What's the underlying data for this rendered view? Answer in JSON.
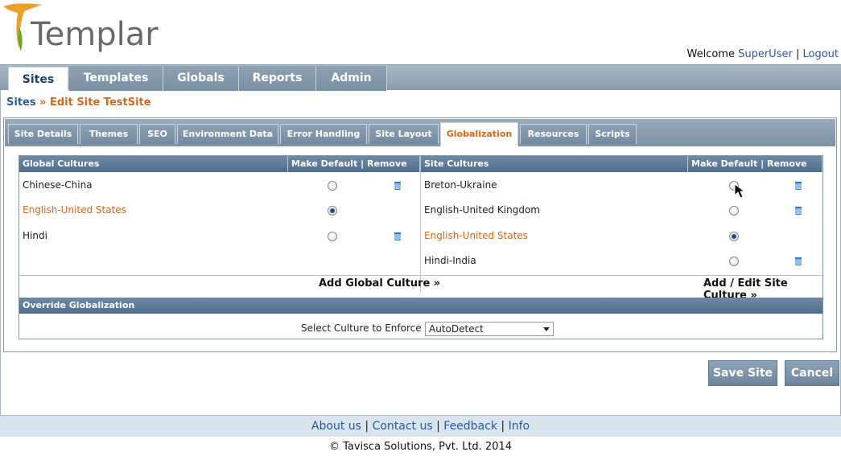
{
  "header": {
    "logo_text": "Templar",
    "welcome": "Welcome",
    "username": "SuperUser",
    "separator": "|",
    "logout": "Logout"
  },
  "mainnav": {
    "tabs": [
      {
        "label": "Sites",
        "active": true
      },
      {
        "label": "Templates",
        "active": false
      },
      {
        "label": "Globals",
        "active": false
      },
      {
        "label": "Reports",
        "active": false
      },
      {
        "label": "Admin",
        "active": false
      }
    ]
  },
  "breadcrumb": {
    "root": "Sites",
    "rest": " » Edit Site TestSite"
  },
  "subtabs": [
    {
      "label": "Site Details"
    },
    {
      "label": "Themes"
    },
    {
      "label": "SEO"
    },
    {
      "label": "Environment Data"
    },
    {
      "label": "Error Handling"
    },
    {
      "label": "Site Layout"
    },
    {
      "label": "Globalization",
      "active": true
    },
    {
      "label": "Resources"
    },
    {
      "label": "Scripts"
    }
  ],
  "global_cultures": {
    "header": "Global Cultures",
    "actions_header": "Make Default | Remove",
    "rows": [
      {
        "name": "Chinese-China",
        "default": false,
        "removable": true
      },
      {
        "name": "English-United States",
        "default": true,
        "removable": false
      },
      {
        "name": "Hindi",
        "default": false,
        "removable": true
      }
    ],
    "add_link": "Add Global Culture »"
  },
  "site_cultures": {
    "header": "Site Cultures",
    "actions_header": "Make Default | Remove",
    "rows": [
      {
        "name": "Breton-Ukraine",
        "default": false,
        "removable": true
      },
      {
        "name": "English-United Kingdom",
        "default": false,
        "removable": true
      },
      {
        "name": "English-United States",
        "default": true,
        "removable": false
      },
      {
        "name": "Hindi-India",
        "default": false,
        "removable": true
      }
    ],
    "add_link": "Add / Edit Site Culture »"
  },
  "override": {
    "header": "Override Globalization",
    "label": "Select Culture to Enforce",
    "selected": "AutoDetect"
  },
  "buttons": {
    "save": "Save Site",
    "cancel": "Cancel"
  },
  "footer": {
    "about": "About us",
    "contact": "Contact us",
    "feedback": "Feedback",
    "info": "Info",
    "sep": "|",
    "copyright": "© Tavisca Solutions, Pvt. Ltd. 2014"
  },
  "colors": {
    "accent_orange": "#d2691e",
    "link_blue": "#2a5a9a",
    "nav_blue": "#7b8fa2"
  }
}
